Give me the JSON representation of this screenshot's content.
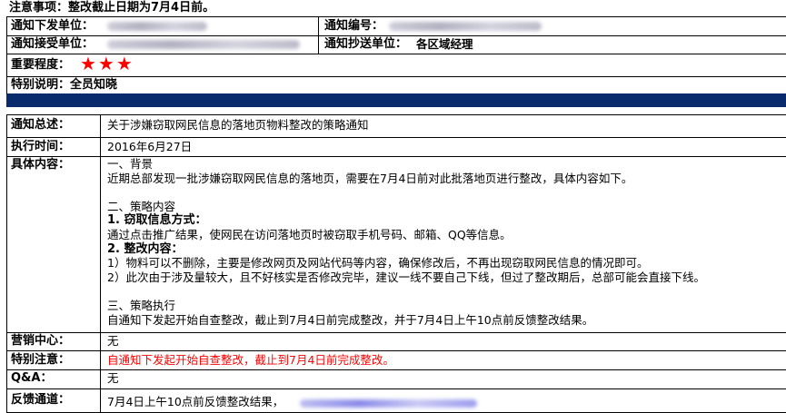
{
  "notice": "注意事项：整改截止日期为7月4日前。",
  "header": {
    "issuer_label": "通知下发单位：",
    "number_label": "通知编号：",
    "receiver_label": "通知接受单位：",
    "cc_label": "通知抄送单位：",
    "cc_value": "各区域经理",
    "importance_label": "重要程度：",
    "importance_stars": "★★★",
    "special_note": "特别说明：全员知晓"
  },
  "rows": {
    "summary_label": "通知总述：",
    "summary_value": "关于涉嫌窃取网民信息的落地页物料整改的策略通知",
    "exec_time_label": "执行时间：",
    "exec_time_value": "2016年6月27日",
    "details_label": "具体内容：",
    "marketing_label": "营销中心：",
    "marketing_value": "无",
    "special_label": "特别注意：",
    "special_value": "自通知下发起开始自查整改，截止到7月4日前完成整改。",
    "qa_label": "Q&A：",
    "qa_value": "无",
    "feedback_label": "反馈通道：",
    "feedback_value": "7月4日上午10点前反馈整改结果，"
  },
  "details": {
    "s1_title": "一、背景",
    "s1_body": "近期总部发现一批涉嫌窃取网民信息的落地页，需要在7月4日前对此批落地页进行整改，具体内容如下。",
    "s2_title": "二、策略内容",
    "s2_h1": "1. 窃取信息方式：",
    "s2_p1": "通过点击推广结果，使网民在访问落地页时被窃取手机号码、邮箱、QQ等信息。",
    "s2_h2": "2. 整改内容：",
    "s2_p2": "1）物料可以不删除，主要是修改网页及网站代码等内容，确保修改后，不再出现窃取网民信息的情况即可。",
    "s2_p3": "2）此次由于涉及量较大，且不好核实是否修改完毕，建议一线不要自己下线，但过了整改期后，总部可能会直接下线。",
    "s3_title": "三、策略执行",
    "s3_body": "自通知下发起开始自查整改，截止到7月4日前完成整改，并于7月4日上午10点前反馈整改结果。"
  }
}
